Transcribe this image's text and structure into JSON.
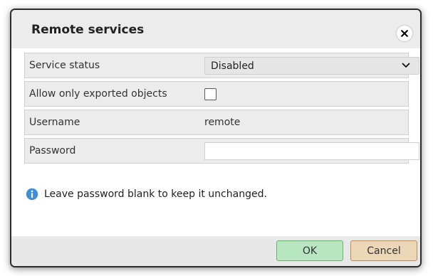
{
  "dialog": {
    "title": "Remote services",
    "close_icon": "close-icon"
  },
  "form": {
    "rows": [
      {
        "label": "Service status",
        "type": "select",
        "value": "Disabled"
      },
      {
        "label": "Allow only exported objects",
        "type": "checkbox",
        "checked": false
      },
      {
        "label": "Username",
        "type": "text",
        "value": "remote"
      },
      {
        "label": "Password",
        "type": "password",
        "value": ""
      }
    ]
  },
  "info": {
    "icon": "info-icon",
    "text": "Leave password blank to keep it unchanged."
  },
  "footer": {
    "ok_label": "OK",
    "cancel_label": "Cancel"
  },
  "colors": {
    "ok_bg": "#b8e6c0",
    "cancel_bg": "#ecd7b7",
    "info_blue": "#3f8ed8"
  }
}
